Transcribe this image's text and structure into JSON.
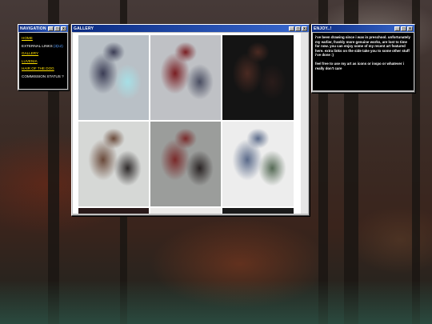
{
  "navigation": {
    "title": "NAVIGATION",
    "items": [
      {
        "label": "HOME",
        "link": true
      },
      {
        "label": "EXTERNAL LINKS",
        "link": false,
        "count": "(3|12)"
      },
      {
        "label": "GALLERY",
        "link": true
      },
      {
        "label": "LUVENIA",
        "link": true
      },
      {
        "label": "HAIR OF THE DOG",
        "link": true
      },
      {
        "label": "COMMISSION STATUS ?",
        "link": false
      }
    ]
  },
  "gallery": {
    "title": "GALLERY",
    "images": [
      {
        "name": "pony-character-sketch",
        "colors": [
          "#b9c0c6",
          "#a6dfe6",
          "#3b3d55"
        ]
      },
      {
        "name": "grey-pony-reference",
        "colors": [
          "#bfc1c5",
          "#4a4e62",
          "#7a1e22"
        ]
      },
      {
        "name": "dark-room-scene",
        "colors": [
          "#141414",
          "#2a1c1a",
          "#4a2a22"
        ]
      },
      {
        "name": "wolf-character-reference",
        "colors": [
          "#d6d8d6",
          "#2e2a2a",
          "#6a4a3a"
        ]
      },
      {
        "name": "sitting-wolf-plaid",
        "colors": [
          "#9b9d9b",
          "#2a2424",
          "#7a2a2a"
        ]
      },
      {
        "name": "sketch-group-scene",
        "colors": [
          "#ededed",
          "#556a55",
          "#5a6a8a"
        ]
      }
    ],
    "partial_row_colors": [
      "#2a1a1a",
      "#ecebe9",
      "#1a1a1a"
    ]
  },
  "enjoy": {
    "title": "ENJOY..!",
    "paragraph1": "i've been drawing since i was in preschool. unfortunately my earlier, frankly more genuine works, are lost to time for now. you can enjoy some of my recent art featured here. extra links on the side take you to some other stuff i've done :)",
    "paragraph2": "feel free to use my art as icons or inspo or whatever i really don't care"
  },
  "window_buttons": {
    "minimize": "_",
    "maximize": "□",
    "close": "x"
  }
}
